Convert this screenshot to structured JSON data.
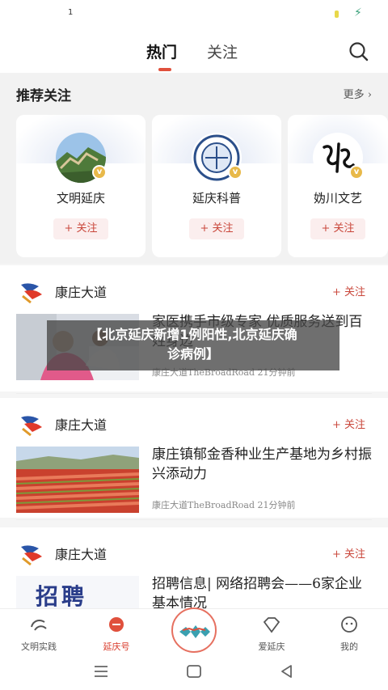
{
  "status_bar": {
    "left_text": "1"
  },
  "top_nav": {
    "tabs": [
      "热门",
      "关注"
    ]
  },
  "recommend": {
    "title": "推荐关注",
    "more": "更多 ›",
    "cards": [
      {
        "name": "文明延庆",
        "follow": "+ 关注"
      },
      {
        "name": "延庆科普",
        "follow": "+ 关注"
      },
      {
        "name": "妫川文艺",
        "follow": "+ 关注"
      }
    ]
  },
  "feed": [
    {
      "source": "康庄大道",
      "follow": "+ 关注",
      "headline": "家医携手市级专家 优质服务送到百姓身边",
      "meta": "康庄大道TheBroadRoad  21分钟前"
    },
    {
      "source": "康庄大道",
      "follow": "+ 关注",
      "headline": "康庄镇郁金香种业生产基地为乡村振兴添动力",
      "meta": "康庄大道TheBroadRoad  21分钟前"
    },
    {
      "source": "康庄大道",
      "follow": "+ 关注",
      "headline": "招聘信息| 网络招聘会——6家企业基本情况",
      "thumb_text": "招聘"
    }
  ],
  "overlay": {
    "line1": "【北京延庆新增1例阳性,北京延庆确",
    "line2": "诊病例】"
  },
  "bottom_nav": [
    {
      "label": "文明实践",
      "icon": "civilization-logo-icon"
    },
    {
      "label": "延庆号",
      "icon": "yanqing-hao-icon"
    },
    {
      "label": "",
      "icon": "center-logo-icon"
    },
    {
      "label": "爱延庆",
      "icon": "diamond-icon"
    },
    {
      "label": "我的",
      "icon": "profile-icon"
    }
  ],
  "colors": {
    "accent": "#d83a2a",
    "follow": "#c9463a",
    "underline": "#e0503c"
  }
}
